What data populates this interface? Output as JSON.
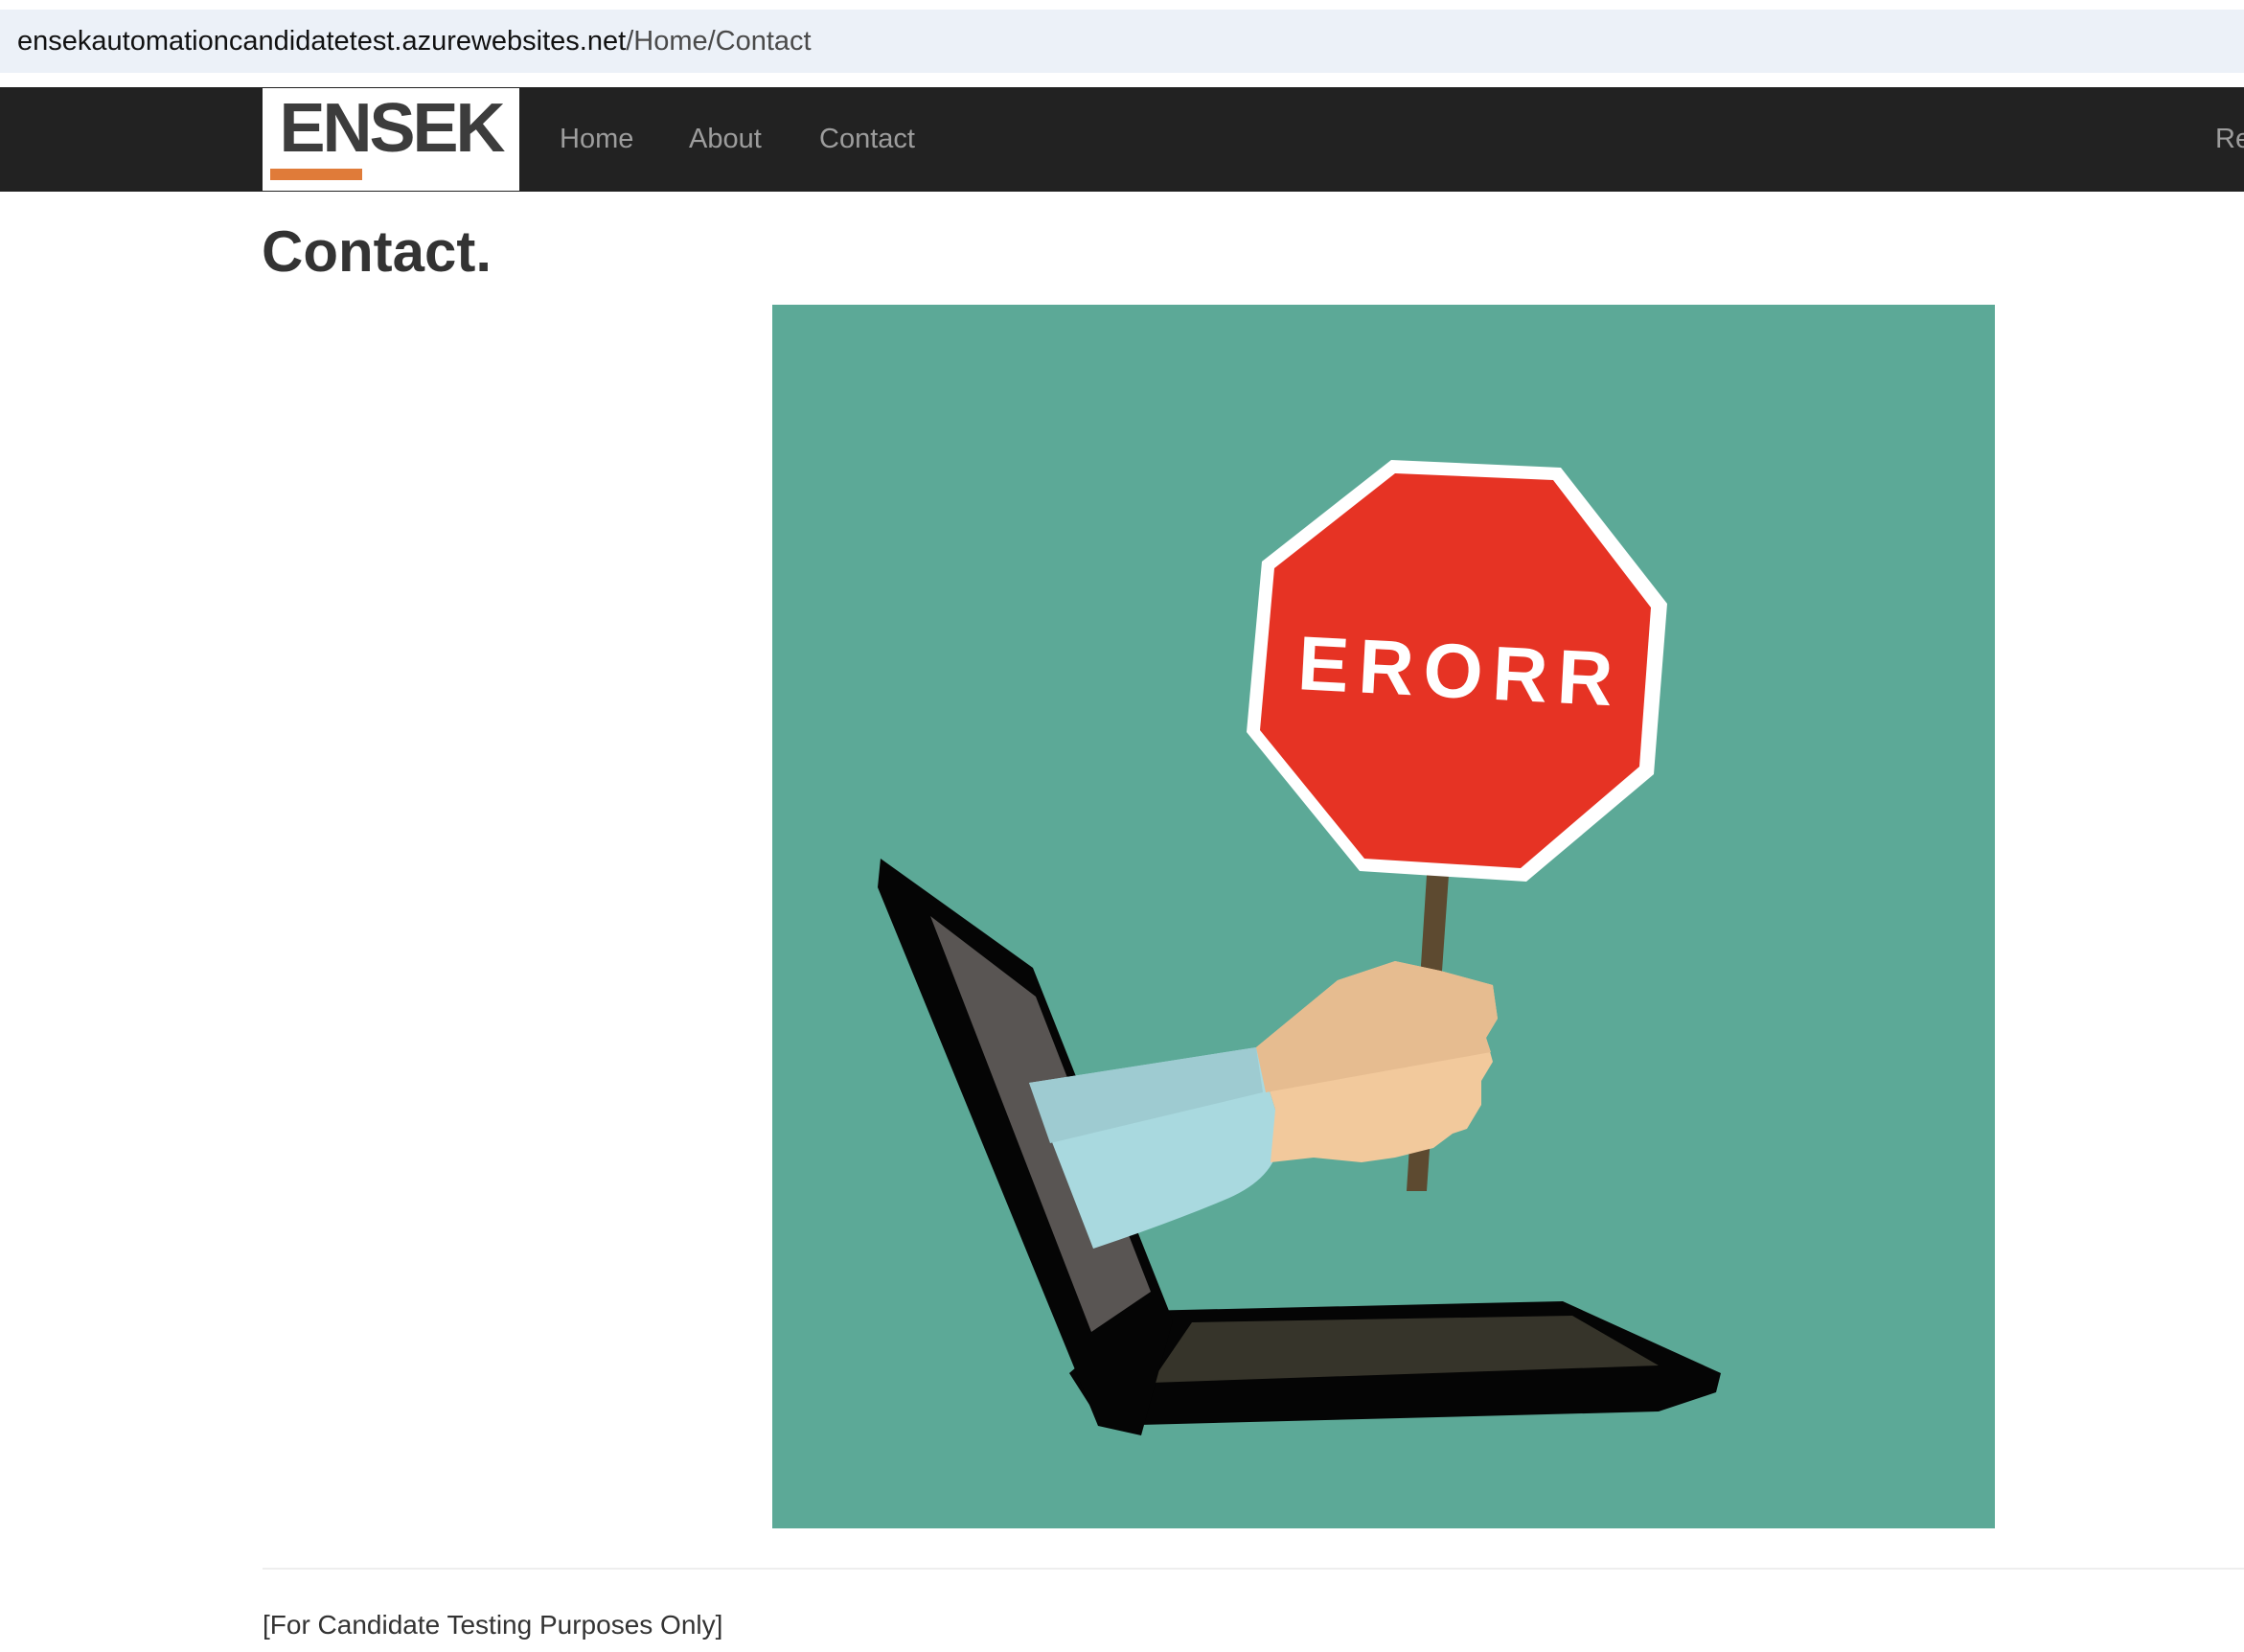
{
  "browser": {
    "url_host": "ensekautomationcandidatetest.azurewebsites.net",
    "url_path": "/Home/Contact"
  },
  "navbar": {
    "logo_text": "ENSEK",
    "logo_accent_color": "#e07b39",
    "items": [
      {
        "label": "Home"
      },
      {
        "label": "About"
      },
      {
        "label": "Contact"
      },
      {
        "label": "Re"
      }
    ]
  },
  "main": {
    "title": "Contact.",
    "image": {
      "sign_text": "ERORR",
      "background_color": "#5ca997",
      "sign_color": "#e63324"
    }
  },
  "footer": {
    "text": "[For Candidate Testing Purposes Only]"
  }
}
